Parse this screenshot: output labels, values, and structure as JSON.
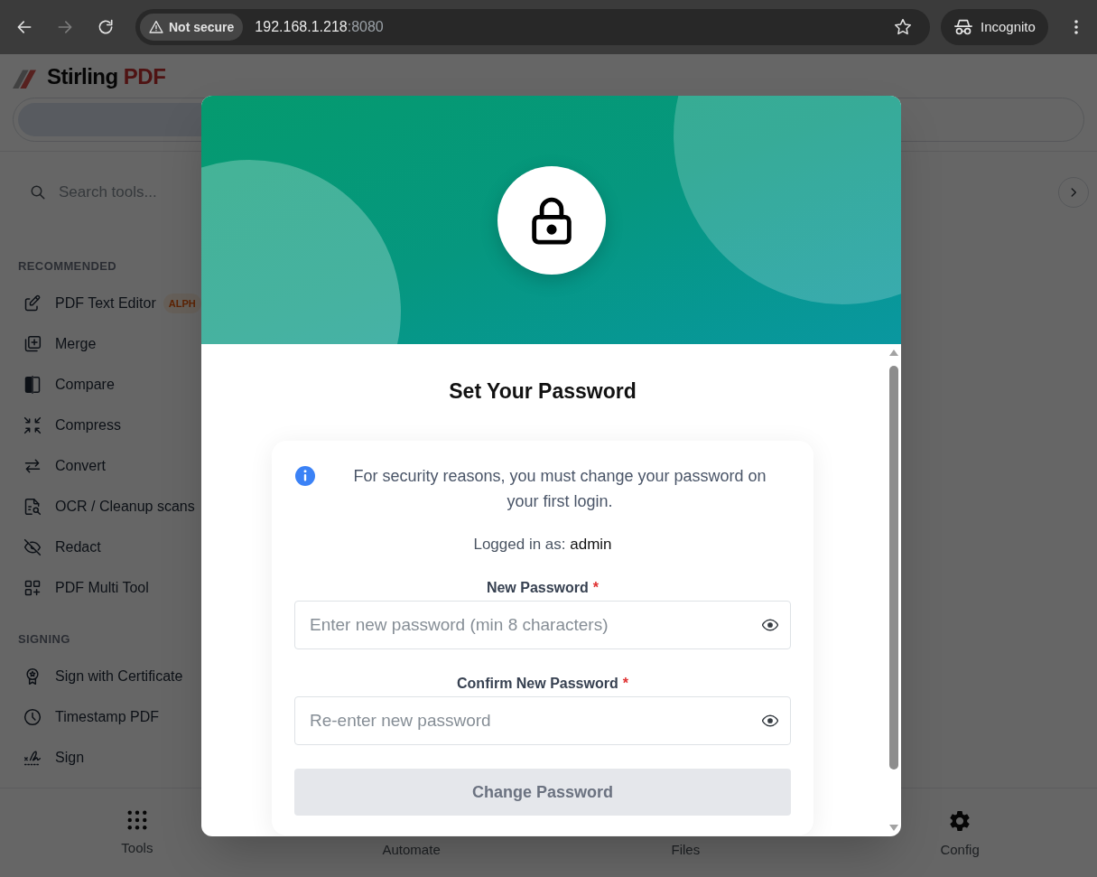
{
  "browser": {
    "nav_buttons": [
      {
        "kind": "back",
        "disabled": false
      },
      {
        "kind": "forward",
        "disabled": true
      },
      {
        "kind": "reload",
        "disabled": false
      }
    ],
    "address_bar": {
      "security_label": "Not secure",
      "host": "192.168.1.218",
      "port": ":8080"
    },
    "profile_chip": "Incognito"
  },
  "app": {
    "logo": {
      "name": "Stirling",
      "suffix": "PDF"
    },
    "search": {
      "placeholder": "Search tools..."
    },
    "sections": [
      {
        "heading": "RECOMMENDED",
        "items": [
          {
            "label": "PDF Text Editor",
            "badge": "ALPH"
          },
          {
            "label": "Merge"
          },
          {
            "label": "Compare"
          },
          {
            "label": "Compress"
          },
          {
            "label": "Convert"
          },
          {
            "label": "OCR / Cleanup scans"
          },
          {
            "label": "Redact"
          },
          {
            "label": "PDF Multi Tool"
          }
        ]
      },
      {
        "heading": "SIGNING",
        "items": [
          {
            "label": "Sign with Certificate"
          },
          {
            "label": "Timestamp PDF"
          },
          {
            "label": "Sign"
          }
        ]
      }
    ],
    "bottom_nav": [
      {
        "kind": "tools",
        "label": "Tools"
      },
      {
        "kind": "automate",
        "label": "Automate"
      },
      {
        "kind": "files",
        "label": "Files"
      },
      {
        "kind": "config",
        "label": "Config"
      }
    ]
  },
  "dialog": {
    "title": "Set Your Password",
    "notice": "For security reasons, you must change your password on your first login.",
    "login_label": "Logged in as:",
    "login_user": "admin",
    "fields": [
      {
        "label": "New Password",
        "required_mark": "*",
        "placeholder": "Enter new password (min 8 characters)"
      },
      {
        "label": "Confirm New Password",
        "required_mark": "*",
        "placeholder": "Re-enter new password"
      }
    ],
    "submit": {
      "label": "Change Password",
      "disabled": true
    }
  }
}
